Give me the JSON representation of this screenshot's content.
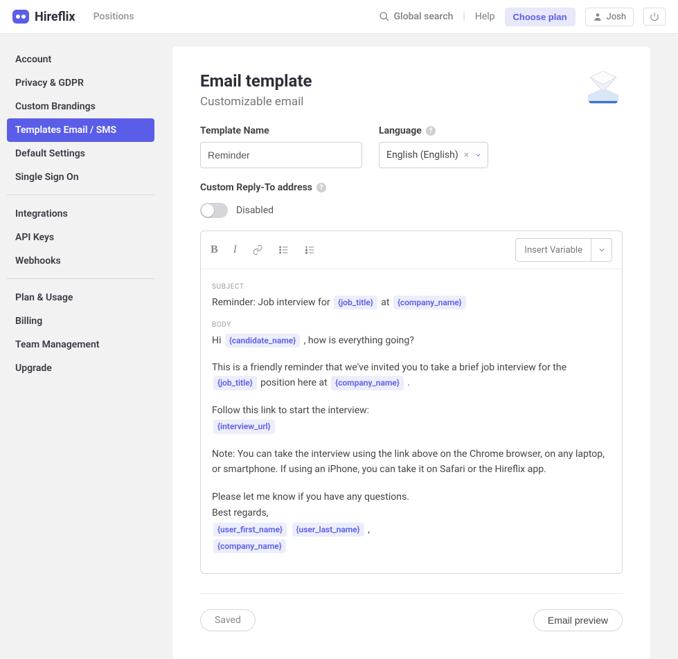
{
  "header": {
    "brand": "Hireflix",
    "nav_positions": "Positions",
    "global_search": "Global search",
    "help": "Help",
    "choose_plan": "Choose plan",
    "user_name": "Josh"
  },
  "sidebar": {
    "group1": [
      "Account",
      "Privacy & GDPR",
      "Custom Brandings",
      "Templates Email / SMS",
      "Default Settings",
      "Single Sign On"
    ],
    "group2": [
      "Integrations",
      "API Keys",
      "Webhooks"
    ],
    "group3": [
      "Plan & Usage",
      "Billing",
      "Team Management",
      "Upgrade"
    ],
    "active": "Templates Email / SMS"
  },
  "page": {
    "title": "Email template",
    "subtitle": "Customizable email",
    "template_name_label": "Template Name",
    "template_name_value": "Reminder",
    "language_label": "Language",
    "language_value": "English (English)",
    "reply_to_label": "Custom Reply-To address",
    "reply_to_state": "Disabled",
    "insert_variable": "Insert Variable",
    "subject_label": "SUBJECT",
    "body_label": "BODY",
    "saved": "Saved",
    "preview": "Email preview"
  },
  "subject": {
    "prefix": "Reminder: Job interview for ",
    "mid": " at ",
    "var1": "{job_title}",
    "var2": "{company_name}"
  },
  "body": {
    "line1_a": "Hi ",
    "line1_var": "{candidate_name}",
    "line1_b": " , how is everything going?",
    "line2_a": "This is a friendly reminder that we've invited you to take a brief job interview for the ",
    "line2_var1": "{job_title}",
    "line2_b": " position here at ",
    "line2_var2": "{company_name}",
    "line2_c": " .",
    "line3": " Follow this link to start the interview:",
    "line3_var": "{interview_url}",
    "line4": "Note: You can take the interview using the link above on the Chrome browser, on any laptop, or smartphone. If using an iPhone, you can take it on Safari or the Hireflix app.",
    "line5": "Please let me know if you have any questions.",
    "line6": "Best regards,",
    "sig_var1": "{user_first_name}",
    "sig_var2": "{user_last_name}",
    "sig_comma": " ,",
    "sig_var3": "{company_name}"
  }
}
